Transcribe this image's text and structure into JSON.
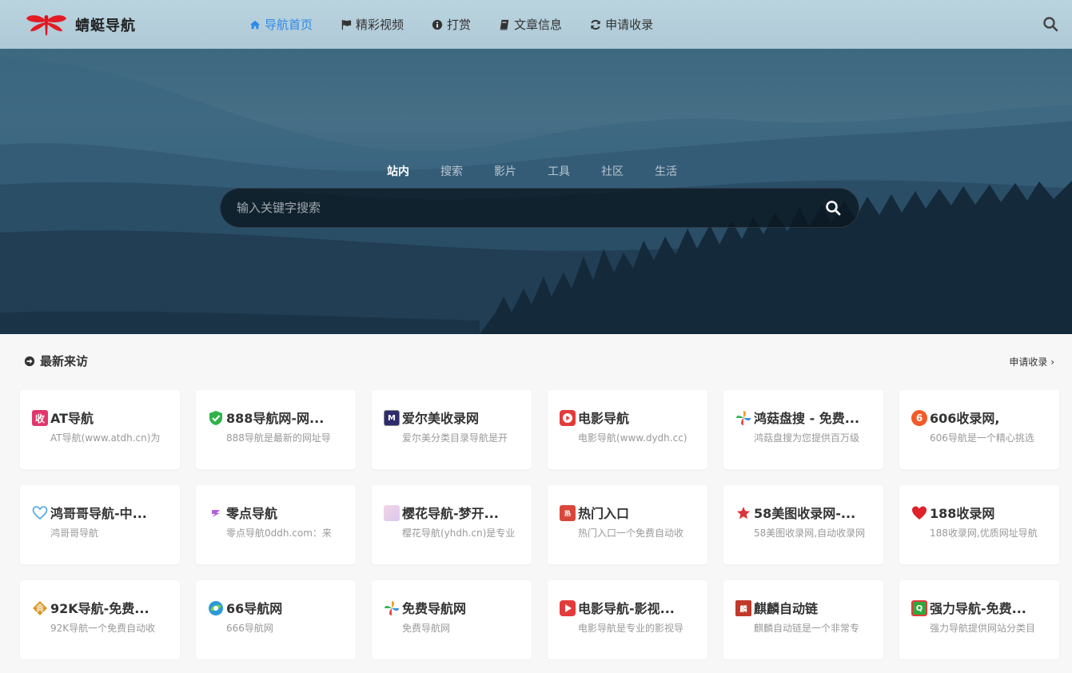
{
  "header": {
    "logo_text": "蜻蜓导航",
    "nav": [
      {
        "label": "导航首页",
        "icon": "home-icon",
        "active": true
      },
      {
        "label": "精彩视频",
        "icon": "flag-icon",
        "active": false
      },
      {
        "label": "打赏",
        "icon": "info-icon",
        "active": false
      },
      {
        "label": "文章信息",
        "icon": "book-icon",
        "active": false
      },
      {
        "label": "申请收录",
        "icon": "refresh-icon",
        "active": false
      }
    ],
    "search_icon": "search-icon"
  },
  "hero": {
    "tabs": [
      "站内",
      "搜索",
      "影片",
      "工具",
      "社区",
      "生活"
    ],
    "active_tab": "站内",
    "search_placeholder": "输入关键字搜索"
  },
  "recent": {
    "title": "最新来访",
    "apply_link": "申请收录 ›",
    "cards": [
      {
        "title": "AT导航",
        "desc": "AT导航(www.atdh.cn)为",
        "icon": "shou-icon",
        "color": "#e2366f"
      },
      {
        "title": "888导航网-网...",
        "desc": "888导航是最新的网址导",
        "icon": "shield-check-icon",
        "color": "#2fb24a"
      },
      {
        "title": "爱尔美收录网",
        "desc": "爱尔美分类目录导航是开",
        "icon": "aim-logo-icon",
        "color": "#2d2b6e"
      },
      {
        "title": "电影导航",
        "desc": "电影导航(www.dydh.cc)",
        "icon": "play-icon",
        "color": "#e33b3b"
      },
      {
        "title": "鸿菇盘搜 - 免费...",
        "desc": "鸿菇盘搜为您提供百万级",
        "icon": "pinwheel-icon",
        "color": "#f0a030"
      },
      {
        "title": "606收录网,",
        "desc": "606导航是一个精心挑选",
        "icon": "six-icon",
        "color": "#f25a2a"
      },
      {
        "title": "鸿哥哥导航-中...",
        "desc": "鸿哥哥导航",
        "icon": "heart-outline-icon",
        "color": "#4aa8e0"
      },
      {
        "title": "零点导航",
        "desc": "零点导航0ddh.com：来",
        "icon": "zero-icon",
        "color": "#b35ee0"
      },
      {
        "title": "樱花导航-梦开...",
        "desc": "樱花导航(yhdh.cn)是专业",
        "icon": "sakura-icon",
        "color": "#e8c0d8"
      },
      {
        "title": "热门入口",
        "desc": "热门入口一个免费自动收",
        "icon": "hot-icon",
        "color": "#d9473b"
      },
      {
        "title": "58美图收录网-...",
        "desc": "58美图收录网,自动收录网",
        "icon": "star-icon",
        "color": "#d9343b"
      },
      {
        "title": "188收录网",
        "desc": "188收录网,优质网址导航",
        "icon": "heart-icon",
        "color": "#e0202a"
      },
      {
        "title": "92K导航-免费...",
        "desc": "92K导航一个免费自动收",
        "icon": "diamond-icon",
        "color": "#d99a2a"
      },
      {
        "title": "66导航网",
        "desc": "666导航网",
        "icon": "circle-logo-icon",
        "color": "#2a9ad9"
      },
      {
        "title": "免费导航网",
        "desc": "免费导航网",
        "icon": "pinwheel-icon",
        "color": "#f0a030"
      },
      {
        "title": "电影导航-影视...",
        "desc": "电影导航是专业的影视导",
        "icon": "play-icon",
        "color": "#e33b3b"
      },
      {
        "title": "麒麟自动链",
        "desc": "麒麟自动链是一个非常专",
        "icon": "seal-icon",
        "color": "#c0392b"
      },
      {
        "title": "强力导航-免费...",
        "desc": "强力导航提供网站分类目",
        "icon": "ql-icon",
        "color": "#2ea83a"
      }
    ]
  }
}
